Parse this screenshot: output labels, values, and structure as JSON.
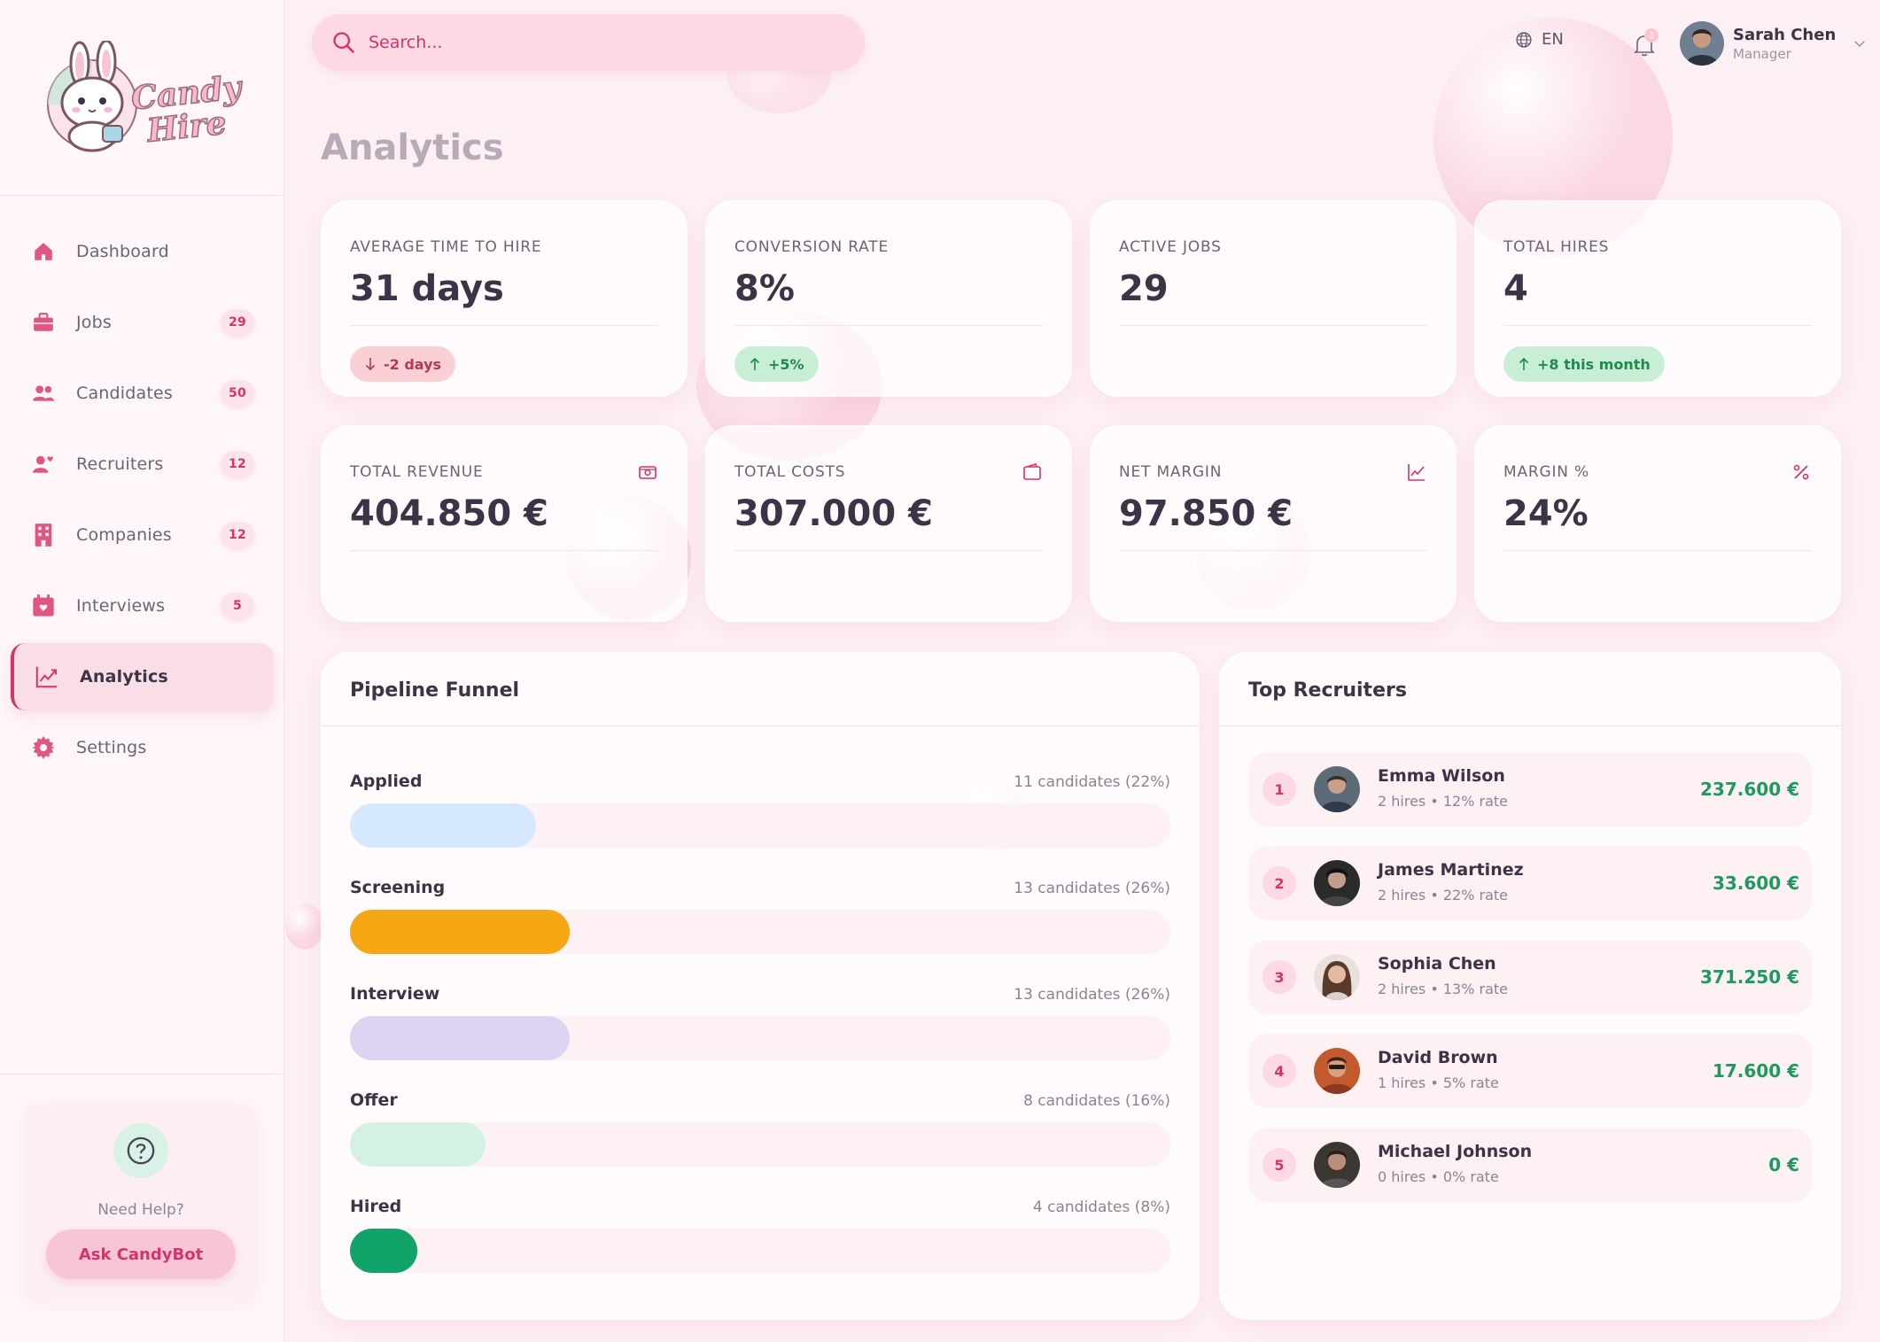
{
  "brand": {
    "name_line1": "Candy",
    "name_line2": "Hire"
  },
  "search": {
    "placeholder": "Search..."
  },
  "header": {
    "language": "EN",
    "notifications_count": "3",
    "user": {
      "name": "Sarah Chen",
      "role": "Manager"
    }
  },
  "sidebar": {
    "items": [
      {
        "label": "Dashboard",
        "icon": "home-icon",
        "badge": ""
      },
      {
        "label": "Jobs",
        "icon": "briefcase-icon",
        "badge": "29"
      },
      {
        "label": "Candidates",
        "icon": "people-icon",
        "badge": "50"
      },
      {
        "label": "Recruiters",
        "icon": "user-heart-icon",
        "badge": "12"
      },
      {
        "label": "Companies",
        "icon": "building-icon",
        "badge": "12"
      },
      {
        "label": "Interviews",
        "icon": "calendar-heart-icon",
        "badge": "5"
      },
      {
        "label": "Analytics",
        "icon": "chart-line-icon",
        "badge": "",
        "active": true
      },
      {
        "label": "Settings",
        "icon": "gear-icon",
        "badge": ""
      }
    ],
    "help": {
      "text": "Need Help?",
      "button": "Ask CandyBot"
    }
  },
  "page": {
    "title": "Analytics"
  },
  "stats": [
    {
      "label": "AVERAGE TIME TO HIRE",
      "value": "31 days",
      "chip": "-2 days",
      "trend": "down"
    },
    {
      "label": "CONVERSION RATE",
      "value": "8%",
      "chip": "+5%",
      "trend": "up"
    },
    {
      "label": "ACTIVE JOBS",
      "value": "29",
      "chip": "",
      "trend": ""
    },
    {
      "label": "TOTAL HIRES",
      "value": "4",
      "chip": "+8 this month",
      "trend": "up"
    }
  ],
  "finance": [
    {
      "label": "TOTAL REVENUE",
      "value": "404.850 €",
      "icon": "cash-icon"
    },
    {
      "label": "TOTAL COSTS",
      "value": "307.000 €",
      "icon": "wallet-icon"
    },
    {
      "label": "NET MARGIN",
      "value": "97.850 €",
      "icon": "trend-up-icon"
    },
    {
      "label": "MARGIN %",
      "value": "24%",
      "icon": "percent-icon"
    }
  ],
  "funnel": {
    "title": "Pipeline Funnel",
    "stages": [
      {
        "label": "Applied",
        "count_text": "11 candidates (22%)",
        "percent": 22,
        "color": "#d6e8fd"
      },
      {
        "label": "Screening",
        "count_text": "13 candidates (26%)",
        "percent": 26,
        "color": "#f5a814"
      },
      {
        "label": "Interview",
        "count_text": "13 candidates (26%)",
        "percent": 26,
        "color": "#ddd3f3"
      },
      {
        "label": "Offer",
        "count_text": "8 candidates (16%)",
        "percent": 16,
        "color": "#d3f2e4"
      },
      {
        "label": "Hired",
        "count_text": "4 candidates (8%)",
        "percent": 8,
        "color": "#12a36a"
      }
    ]
  },
  "recruiters": {
    "title": "Top Recruiters",
    "rows": [
      {
        "rank": "1",
        "name": "Emma Wilson",
        "meta": "2 hires • 12% rate",
        "revenue": "237.600 €"
      },
      {
        "rank": "2",
        "name": "James Martinez",
        "meta": "2 hires • 22% rate",
        "revenue": "33.600 €"
      },
      {
        "rank": "3",
        "name": "Sophia Chen",
        "meta": "2 hires • 13% rate",
        "revenue": "371.250 €"
      },
      {
        "rank": "4",
        "name": "David Brown",
        "meta": "1 hires • 5% rate",
        "revenue": "17.600 €"
      },
      {
        "rank": "5",
        "name": "Michael Johnson",
        "meta": "0 hires • 0% rate",
        "revenue": "0 €"
      }
    ]
  },
  "colors": {
    "accent": "#d6336c",
    "positive": "#1e9a5e",
    "background": "#fdf0f4"
  }
}
